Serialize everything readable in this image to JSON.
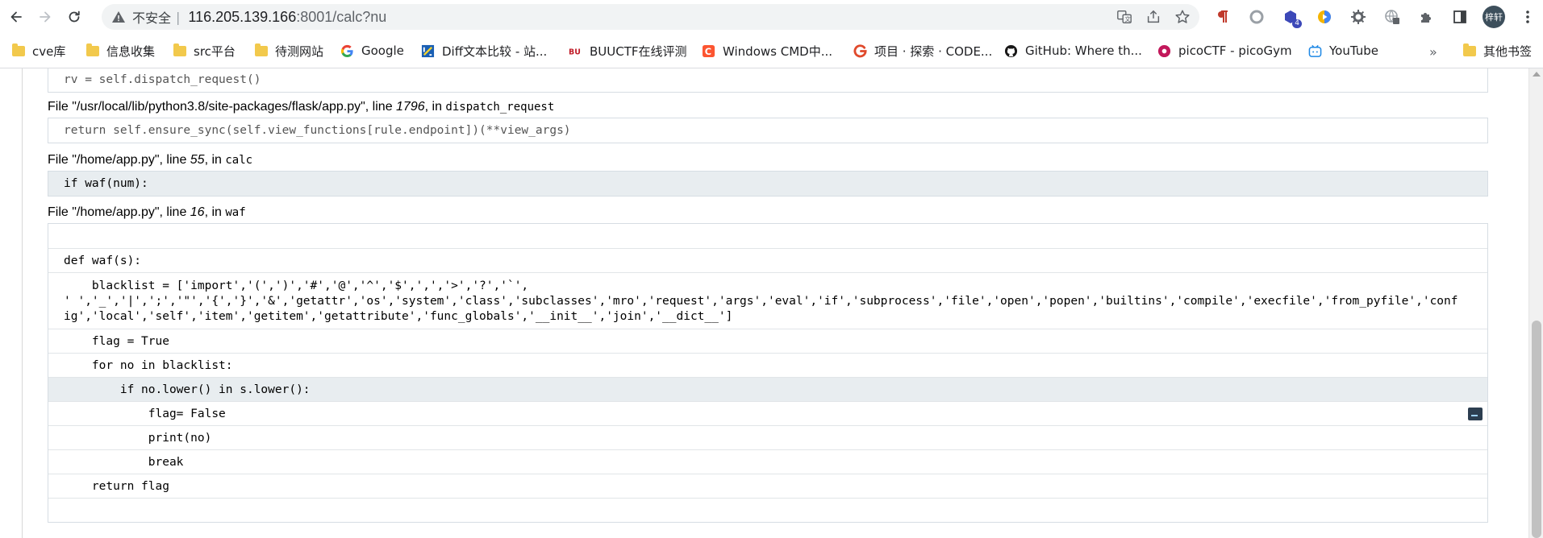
{
  "browser": {
    "insecure_label": "不安全",
    "separator": "|",
    "url_host": "116.205.139.166",
    "url_port": ":8001/calc?nu",
    "avatar_label": "梓轩",
    "extension_badge": "4"
  },
  "bookmarks": {
    "items": [
      {
        "label": "cve库",
        "icon": "folder-icon"
      },
      {
        "label": "信息收集",
        "icon": "folder-icon"
      },
      {
        "label": "src平台",
        "icon": "folder-icon"
      },
      {
        "label": "待测网站",
        "icon": "folder-icon"
      },
      {
        "label": "Google",
        "icon": "google-icon"
      },
      {
        "label": "Diff文本比较 - 站...",
        "icon": "diff-icon"
      },
      {
        "label": "BUUCTF在线评测",
        "icon": "buuctf-icon"
      },
      {
        "label": "Windows CMD中...",
        "icon": "csdn-icon"
      },
      {
        "label": "项目 · 探索 · CODE...",
        "icon": "gitcode-icon"
      },
      {
        "label": "GitHub: Where th...",
        "icon": "github-icon"
      },
      {
        "label": "picoCTF - picoGym",
        "icon": "picoctf-icon"
      },
      {
        "label": "YouTube",
        "icon": "bilibili-icon"
      }
    ],
    "more": "»",
    "other_label": "其他书签"
  },
  "traceback": {
    "top_line": "rv = self.dispatch_request()",
    "frame1": {
      "prefix": "File \"",
      "path": "/usr/local/lib/python3.8/site-packages/flask/app.py",
      "mid": "\", line ",
      "line": "1796",
      "in": ", in ",
      "func": "dispatch_request",
      "code": "return self.ensure_sync(self.view_functions[rule.endpoint])(**view_args)"
    },
    "frame2": {
      "prefix": "File \"",
      "path": "/home/app.py",
      "mid": "\", line ",
      "line": "55",
      "in": ", in ",
      "func": "calc",
      "code": "if waf(num):"
    },
    "frame3": {
      "prefix": "File \"",
      "path": "/home/app.py",
      "mid": "\", line ",
      "line": "16",
      "in": ", in ",
      "func": "waf",
      "source": [
        "",
        "def waf(s):",
        "    blacklist = ['import','(',')','#','@','^','$',',','>','?','`',\n' ','_','|',';','\"','{','}','&','getattr','os','system','class','subclasses','mro','request','args','eval','if','subprocess','file','open','popen','builtins','compile','execfile','from_pyfile','conf\nig','local','self','item','getitem','getattribute','func_globals','__init__','join','__dict__']",
        "    flag = True",
        "    for no in blacklist:",
        "        if no.lower() in s.lower():",
        "            flag= False",
        "            print(no)",
        "            break",
        "    return flag",
        ""
      ]
    }
  }
}
